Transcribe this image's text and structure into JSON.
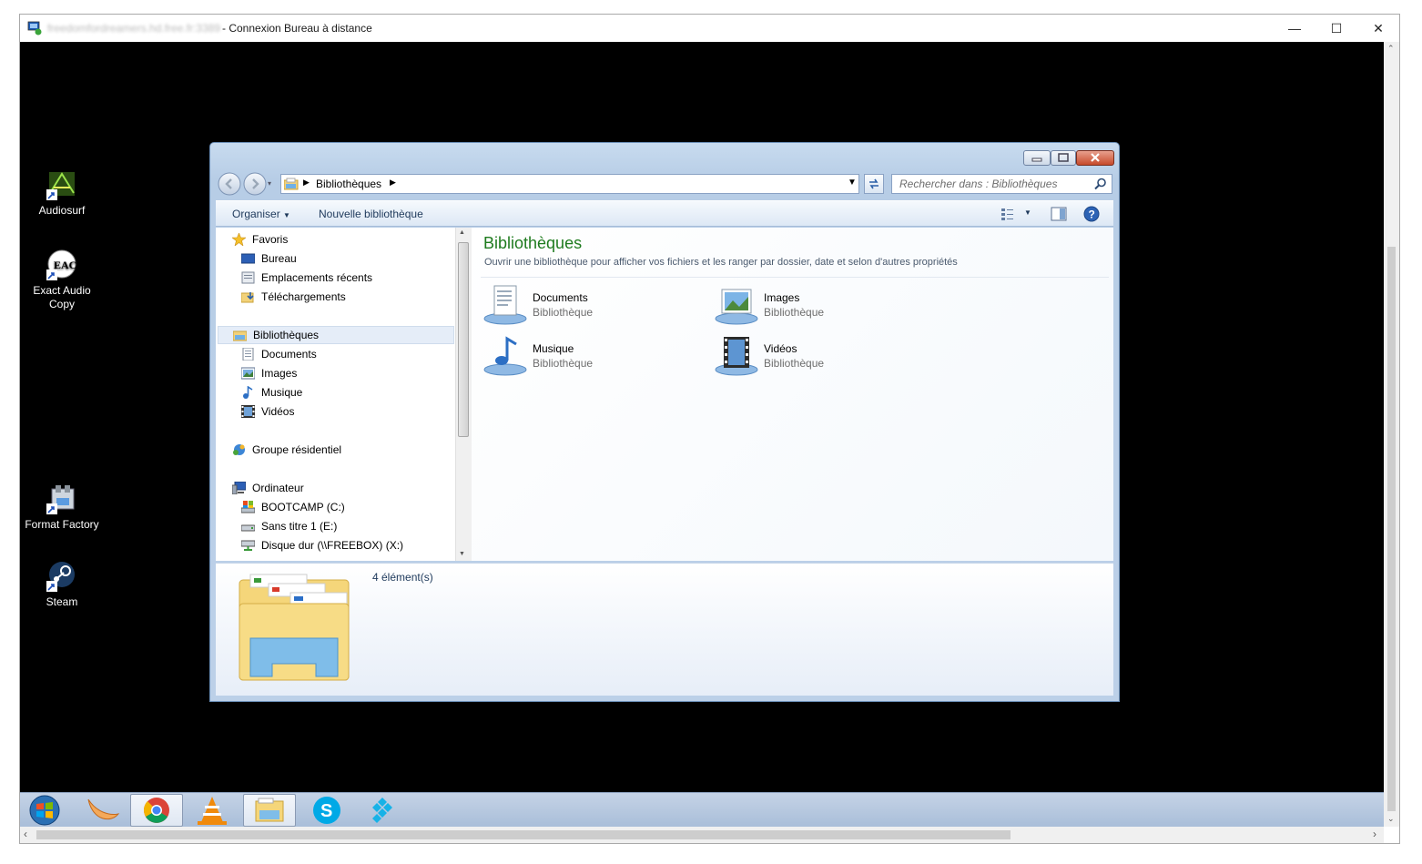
{
  "rdp_window": {
    "host_blurred": "freedomfordreamers.hd.free.fr:3389",
    "title": "- Connexion Bureau à distance",
    "minimize": "—",
    "maximize": "☐",
    "close": "✕"
  },
  "desktop_icons": [
    {
      "label": "Audiosurf"
    },
    {
      "label": "Exact Audio Copy"
    },
    {
      "label": "Format Factory"
    },
    {
      "label": "Steam"
    }
  ],
  "explorer": {
    "breadcrumb": "Bibliothèques",
    "search_placeholder": "Rechercher dans : Bibliothèques",
    "commands": {
      "organize": "Organiser",
      "new_library": "Nouvelle bibliothèque"
    },
    "nav": {
      "favorites": "Favoris",
      "desktop": "Bureau",
      "recent": "Emplacements récents",
      "downloads": "Téléchargements",
      "libraries": "Bibliothèques",
      "documents": "Documents",
      "images": "Images",
      "music": "Musique",
      "videos": "Vidéos",
      "homegroup": "Groupe résidentiel",
      "computer": "Ordinateur",
      "drive_c": "BOOTCAMP (C:)",
      "drive_e": "Sans titre 1 (E:)",
      "drive_x": "Disque dur (\\\\FREEBOX) (X:)"
    },
    "content": {
      "heading": "Bibliothèques",
      "description": "Ouvrir une bibliothèque pour afficher vos fichiers et les ranger par dossier, date et selon d'autres propriétés",
      "items": [
        {
          "name": "Documents",
          "type": "Bibliothèque"
        },
        {
          "name": "Images",
          "type": "Bibliothèque"
        },
        {
          "name": "Musique",
          "type": "Bibliothèque"
        },
        {
          "name": "Vidéos",
          "type": "Bibliothèque"
        }
      ]
    },
    "details": {
      "count": "4 élément(s)"
    }
  },
  "taskbar": {
    "apps": [
      "start-orb",
      "melon-app",
      "chrome",
      "vlc",
      "explorer",
      "skype",
      "kodi"
    ]
  },
  "colors": {
    "heading_green": "#1e7b1e",
    "desktop": "#000000"
  }
}
